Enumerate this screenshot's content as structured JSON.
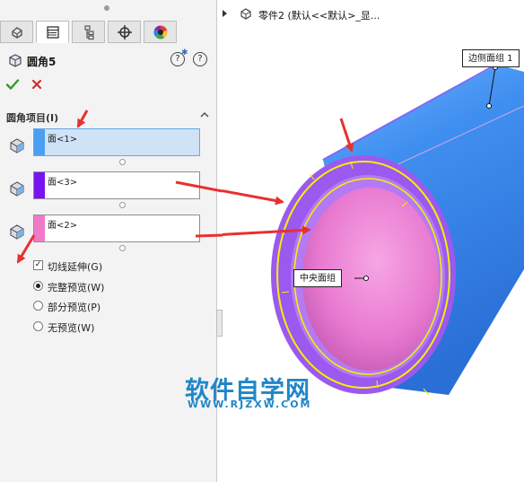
{
  "panel": {
    "tabs": [
      {
        "icon": "feature-manager-icon"
      },
      {
        "icon": "property-manager-icon",
        "active": true
      },
      {
        "icon": "configuration-manager-icon"
      },
      {
        "icon": "dimxpert-icon"
      },
      {
        "icon": "appearance-icon"
      }
    ],
    "title": "圆角5",
    "help_glyph": "?",
    "section_title": "圆角项目(I)",
    "selections": [
      {
        "text": "面<1>",
        "color": "#4a9ff0",
        "active": true
      },
      {
        "text": "面<3>",
        "color": "#7a13f0",
        "active": false
      },
      {
        "text": "面<2>",
        "color": "#f07ac8",
        "active": false
      }
    ],
    "tangent_label": "切线延伸(G)",
    "tangent_checked": true,
    "preview_options": [
      {
        "label": "完整预览(W)",
        "selected": true
      },
      {
        "label": "部分预览(P)",
        "selected": false
      },
      {
        "label": "无预览(W)",
        "selected": false
      }
    ]
  },
  "viewport": {
    "tree_text": "零件2  (默认<<默认>_显...",
    "callout_side": "边侧面组 1",
    "callout_center": "中央面组",
    "watermark_main": "软件自学网",
    "watermark_sub": "WWW.RJZXW.COM"
  },
  "colors": {
    "outer_face": "#3f8ff0",
    "inner_face": "#e87ad0",
    "fillet_face": "#9b59f0",
    "highlight": "#f5f000",
    "arrow": "#e83030"
  }
}
